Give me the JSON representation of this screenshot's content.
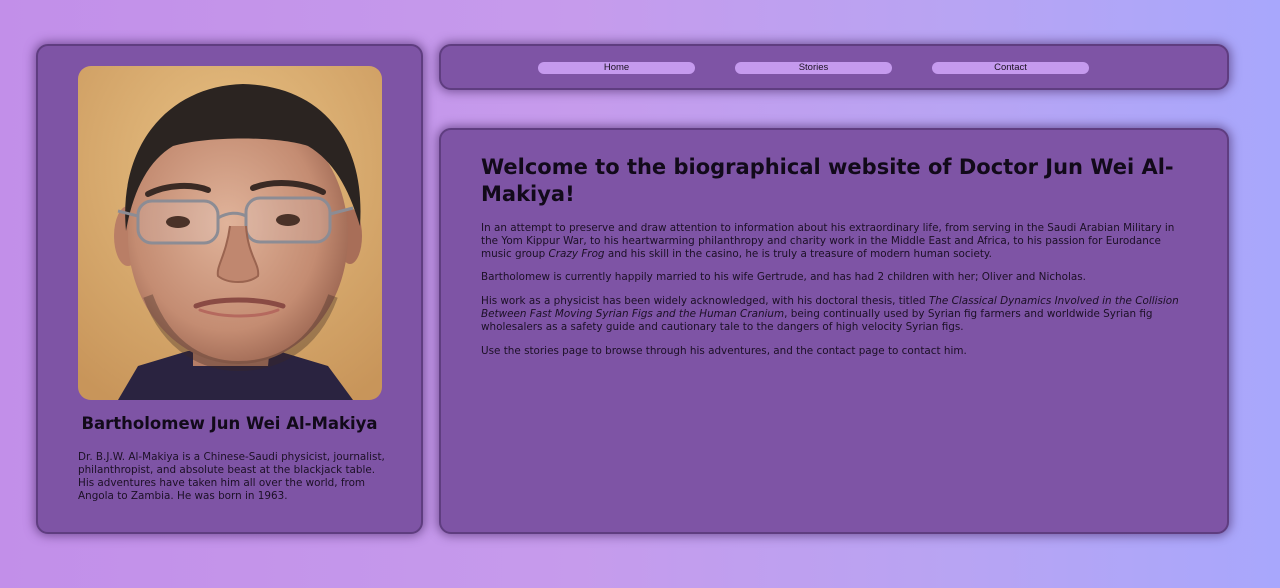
{
  "nav": {
    "home_label": "Home",
    "stories_label": "Stories",
    "contact_label": "Contact"
  },
  "profile": {
    "name": "Bartholomew Jun Wei Al-Makiya",
    "bio": "Dr. B.J.W. Al-Makiya is a Chinese-Saudi physicist, journalist, philanthropist, and absolute beast at the blackjack table. His adventures have taken him all over the world, from Angola to Zambia. He was born in 1963."
  },
  "main": {
    "title": "Welcome to the biographical website of Doctor Jun Wei Al-Makiya!",
    "p1_before": "In an attempt to preserve and draw attention to information about his extraordinary life, from serving in the Saudi Arabian Military in the Yom Kippur War, to his heartwarming philanthropy and charity work in the Middle East and Africa, to his passion for Eurodance music group ",
    "p1_em": "Crazy Frog",
    "p1_after": " and his skill in the casino, he is truly a treasure of modern human society.",
    "p2": "Bartholomew is currently happily married to his wife Gertrude, and has had 2 children with her; Oliver and Nicholas.",
    "p3_before": "His work as a physicist has been widely acknowledged, with his doctoral thesis, titled ",
    "p3_em": "The Classical Dynamics Involved in the Collision Between Fast Moving Syrian Figs and the Human Cranium",
    "p3_after": ", being continually used by Syrian fig farmers and worldwide Syrian fig wholesalers as a safety guide and cautionary tale to the dangers of high velocity Syrian figs.",
    "p4": "Use the stories page to browse through his adventures, and the contact page to contact him."
  },
  "colors": {
    "panel": "#7e54a5",
    "nav_button": "#c59aee",
    "background_left": "#c28fe9",
    "background_right": "#a8a7fc"
  }
}
